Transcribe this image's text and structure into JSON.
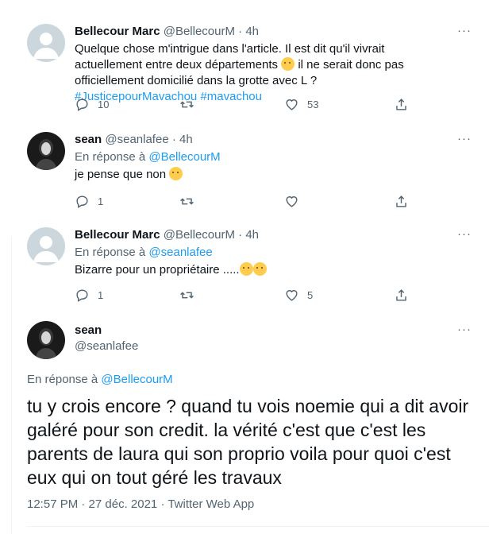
{
  "tweets": [
    {
      "name": "Bellecour Marc",
      "handle": "@BellecourM",
      "separator": "·",
      "time": "4h",
      "more": "···",
      "text_before": "Quelque chose m'intrigue dans l'article. Il est dit qu'il vivrait actuellement entre deux départements ",
      "text_mid": " il ne serait donc pas officiellement domicilié dans la grotte avec L ? ",
      "hashtags": "#JusticepourMavachou #mavachou",
      "emoji": "thinking-face",
      "replies": "10",
      "retweets": "",
      "likes": "53"
    },
    {
      "name": "sean",
      "handle": "@seanlafee",
      "separator": "·",
      "time": "4h",
      "more": "···",
      "reply_prefix": "En réponse à ",
      "reply_to": "@BellecourM",
      "text": "je pense que non ",
      "emoji": "smirking-face",
      "replies": "1",
      "retweets": "",
      "likes": ""
    },
    {
      "name": "Bellecour Marc",
      "handle": "@BellecourM",
      "separator": "·",
      "time": "4h",
      "more": "···",
      "reply_prefix": "En réponse à ",
      "reply_to": "@seanlafee",
      "text": "Bizarre pour un propriétaire .....",
      "emoji": "thinking-face",
      "replies": "1",
      "retweets": "",
      "likes": "5"
    }
  ],
  "main": {
    "name": "sean",
    "handle": "@seanlafee",
    "more": "···",
    "reply_prefix": "En réponse à ",
    "reply_to": "@BellecourM",
    "text": "tu y crois encore ? quand tu vois noemie qui a dit avoir galéré pour son credit. la vérité c'est que c'est les parents de laura qui son proprio voila pour quoi c'est eux qui on tout géré les travaux",
    "timestamp": "12:57 PM · 27 déc. 2021 · Twitter Web App"
  },
  "colors": {
    "link": "#1d9bf0",
    "secondary": "#536471",
    "primary": "#0f1419"
  }
}
